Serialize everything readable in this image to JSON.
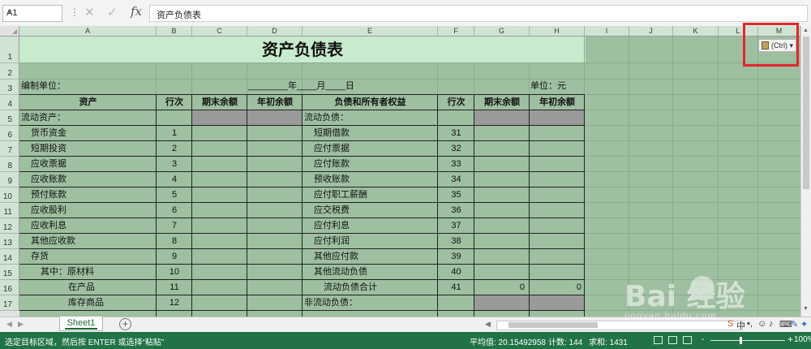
{
  "formula_bar": {
    "name_box": "A1",
    "fx_label": "fx",
    "formula": "资产负债表"
  },
  "columns": [
    "A",
    "B",
    "C",
    "D",
    "E",
    "F",
    "G",
    "H",
    "I",
    "J",
    "K",
    "L",
    "M"
  ],
  "rows": [
    "1",
    "2",
    "3",
    "4",
    "5",
    "6",
    "7",
    "8",
    "9",
    "10",
    "11",
    "12",
    "13",
    "14",
    "15",
    "16",
    "17"
  ],
  "sheet": {
    "title": "资产负债表",
    "unit_label": "编制单位：",
    "date_line": "________年____月____日",
    "unit_currency": "单位：元",
    "headers": [
      "资产",
      "行次",
      "期末余额",
      "年初余额",
      "负债和所有者权益",
      "行次",
      "期末余额",
      "年初余额"
    ],
    "left_rows": [
      {
        "label": "流动资产：",
        "no": ""
      },
      {
        "label": "货币资金",
        "no": "1"
      },
      {
        "label": "短期投资",
        "no": "2"
      },
      {
        "label": "应收票据",
        "no": "3"
      },
      {
        "label": "应收账款",
        "no": "4"
      },
      {
        "label": "预付账款",
        "no": "5"
      },
      {
        "label": "应收股利",
        "no": "6"
      },
      {
        "label": "应收利息",
        "no": "7"
      },
      {
        "label": "其他应收款",
        "no": "8"
      },
      {
        "label": "存货",
        "no": "9"
      },
      {
        "label": "其中：原材料",
        "no": "10"
      },
      {
        "label": "在产品",
        "no": "11"
      },
      {
        "label": "库存商品",
        "no": "12"
      }
    ],
    "right_rows": [
      {
        "label": "流动负债：",
        "no": ""
      },
      {
        "label": "短期借款",
        "no": "31"
      },
      {
        "label": "应付票据",
        "no": "32"
      },
      {
        "label": "应付账款",
        "no": "33"
      },
      {
        "label": "预收账款",
        "no": "34"
      },
      {
        "label": "应付职工薪酬",
        "no": "35"
      },
      {
        "label": "应交税费",
        "no": "36"
      },
      {
        "label": "应付利息",
        "no": "37"
      },
      {
        "label": "应付利润",
        "no": "38"
      },
      {
        "label": "其他应付款",
        "no": "39"
      },
      {
        "label": "其他流动负债",
        "no": "40"
      },
      {
        "label": "流动负债合计",
        "no": "41"
      },
      {
        "label": "非流动负债：",
        "no": ""
      }
    ],
    "row16_values": [
      "0",
      "0"
    ]
  },
  "paste_options": {
    "label": "(Ctrl)",
    "arrow": "▾"
  },
  "tabs": {
    "sheet_name": "Sheet1",
    "add": "+"
  },
  "status_bar": {
    "message": "选定目标区域，然后按 ENTER 或选择“粘贴”",
    "average": "平均值: 20.15492958",
    "count": "计数: 144",
    "sum": "求和: 1431",
    "zoom": "100%",
    "zoom_minus": "-",
    "zoom_plus": "+"
  },
  "watermark": {
    "brand": "Bai  经验",
    "url": "jingyan.baidu.com"
  },
  "colors": {
    "status_green": "#217346",
    "grid_fill": "#9ebfa0",
    "title_fill": "#c7ebcc",
    "highlight_red": "#e3262c"
  }
}
